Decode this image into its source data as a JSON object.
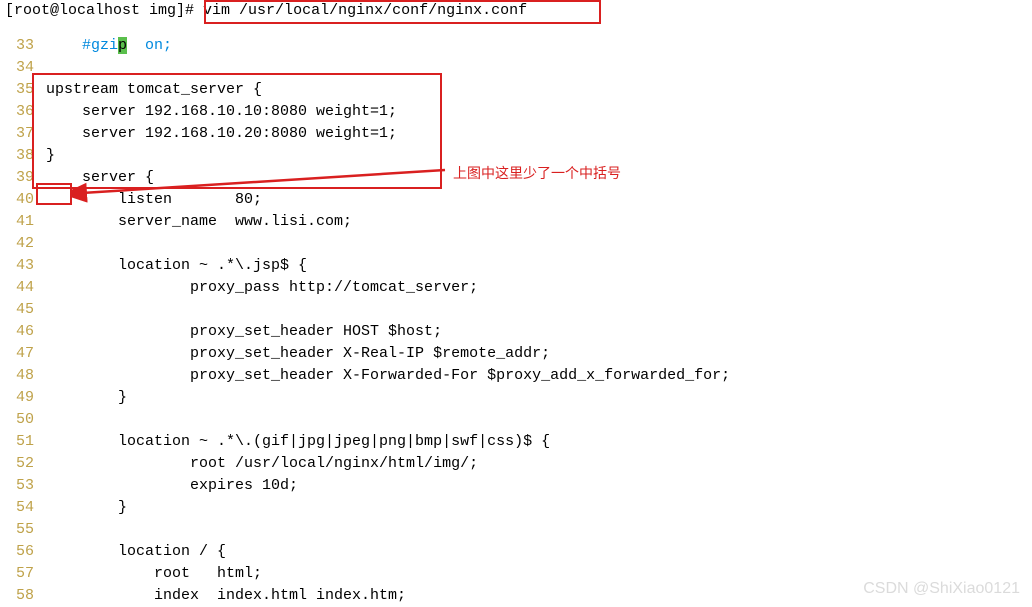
{
  "prompt": {
    "user_host": "[root@localhost img]",
    "hash": "#",
    "command": " vim /usr/local/nginx/conf/nginx.conf"
  },
  "lines": [
    {
      "n": "33",
      "text": "    #gzi",
      "highlight": "p",
      "after": "  on;"
    },
    {
      "n": "34",
      "text": ""
    },
    {
      "n": "35",
      "text": "upstream tomcat_server {"
    },
    {
      "n": "36",
      "text": "    server 192.168.10.10:8080 weight=1;"
    },
    {
      "n": "37",
      "text": "    server 192.168.10.20:8080 weight=1;"
    },
    {
      "n": "38",
      "text": "}"
    },
    {
      "n": "39",
      "text": "    server {"
    },
    {
      "n": "40",
      "text": "        listen       80;"
    },
    {
      "n": "41",
      "text": "        server_name  www.lisi.com;"
    },
    {
      "n": "42",
      "text": ""
    },
    {
      "n": "43",
      "text": "        location ~ .*\\.jsp$ {"
    },
    {
      "n": "44",
      "text": "                proxy_pass http://tomcat_server;"
    },
    {
      "n": "45",
      "text": ""
    },
    {
      "n": "46",
      "text": "                proxy_set_header HOST $host;"
    },
    {
      "n": "47",
      "text": "                proxy_set_header X-Real-IP $remote_addr;"
    },
    {
      "n": "48",
      "text": "                proxy_set_header X-Forwarded-For $proxy_add_x_forwarded_for;"
    },
    {
      "n": "49",
      "text": "        }"
    },
    {
      "n": "50",
      "text": ""
    },
    {
      "n": "51",
      "text": "        location ~ .*\\.(gif|jpg|jpeg|png|bmp|swf|css)$ {"
    },
    {
      "n": "52",
      "text": "                root /usr/local/nginx/html/img/;"
    },
    {
      "n": "53",
      "text": "                expires 10d;"
    },
    {
      "n": "54",
      "text": "        }"
    },
    {
      "n": "55",
      "text": ""
    },
    {
      "n": "56",
      "text": "        location / {"
    },
    {
      "n": "57",
      "text": "            root   html;"
    },
    {
      "n": "58",
      "text": "            index  index.html index.htm;"
    }
  ],
  "annotation": "上图中这里少了一个中括号",
  "watermark": "CSDN @ShiXiao0121"
}
